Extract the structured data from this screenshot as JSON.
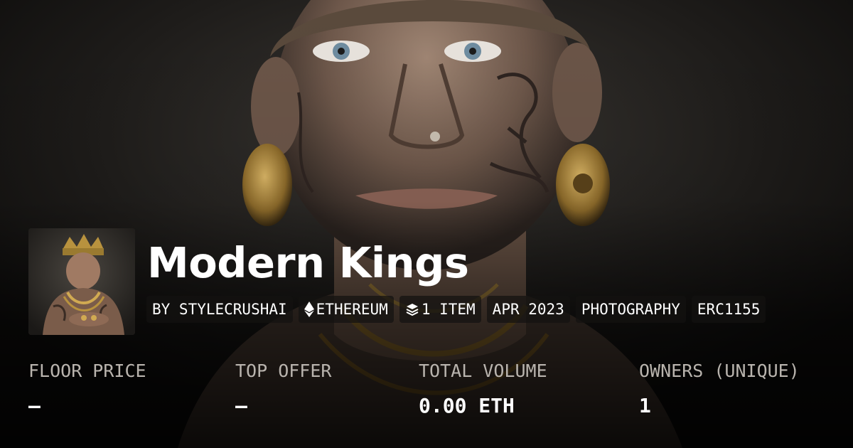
{
  "collection": {
    "title": "Modern Kings",
    "chips": [
      {
        "label": "BY STYLECRUSHAI",
        "icon": ""
      },
      {
        "label": "ETHEREUM",
        "icon": "ethereum-icon"
      },
      {
        "label": "1 ITEM",
        "icon": "layers-icon"
      },
      {
        "label": "APR 2023",
        "icon": ""
      },
      {
        "label": "PHOTOGRAPHY",
        "icon": ""
      },
      {
        "label": "ERC1155",
        "icon": ""
      }
    ]
  },
  "stats": {
    "floor_price": {
      "label": "FLOOR PRICE",
      "value": "–"
    },
    "top_offer": {
      "label": "TOP OFFER",
      "value": "–"
    },
    "total_volume": {
      "label": "TOTAL VOLUME",
      "value": "0.00 ETH"
    },
    "owners": {
      "label": "OWNERS (UNIQUE)",
      "value": "1"
    }
  },
  "colors": {
    "background": "#0c0b0a",
    "text_primary": "#ffffff",
    "text_muted": "#b9b4ae",
    "gold_accent": "#b8923e"
  }
}
